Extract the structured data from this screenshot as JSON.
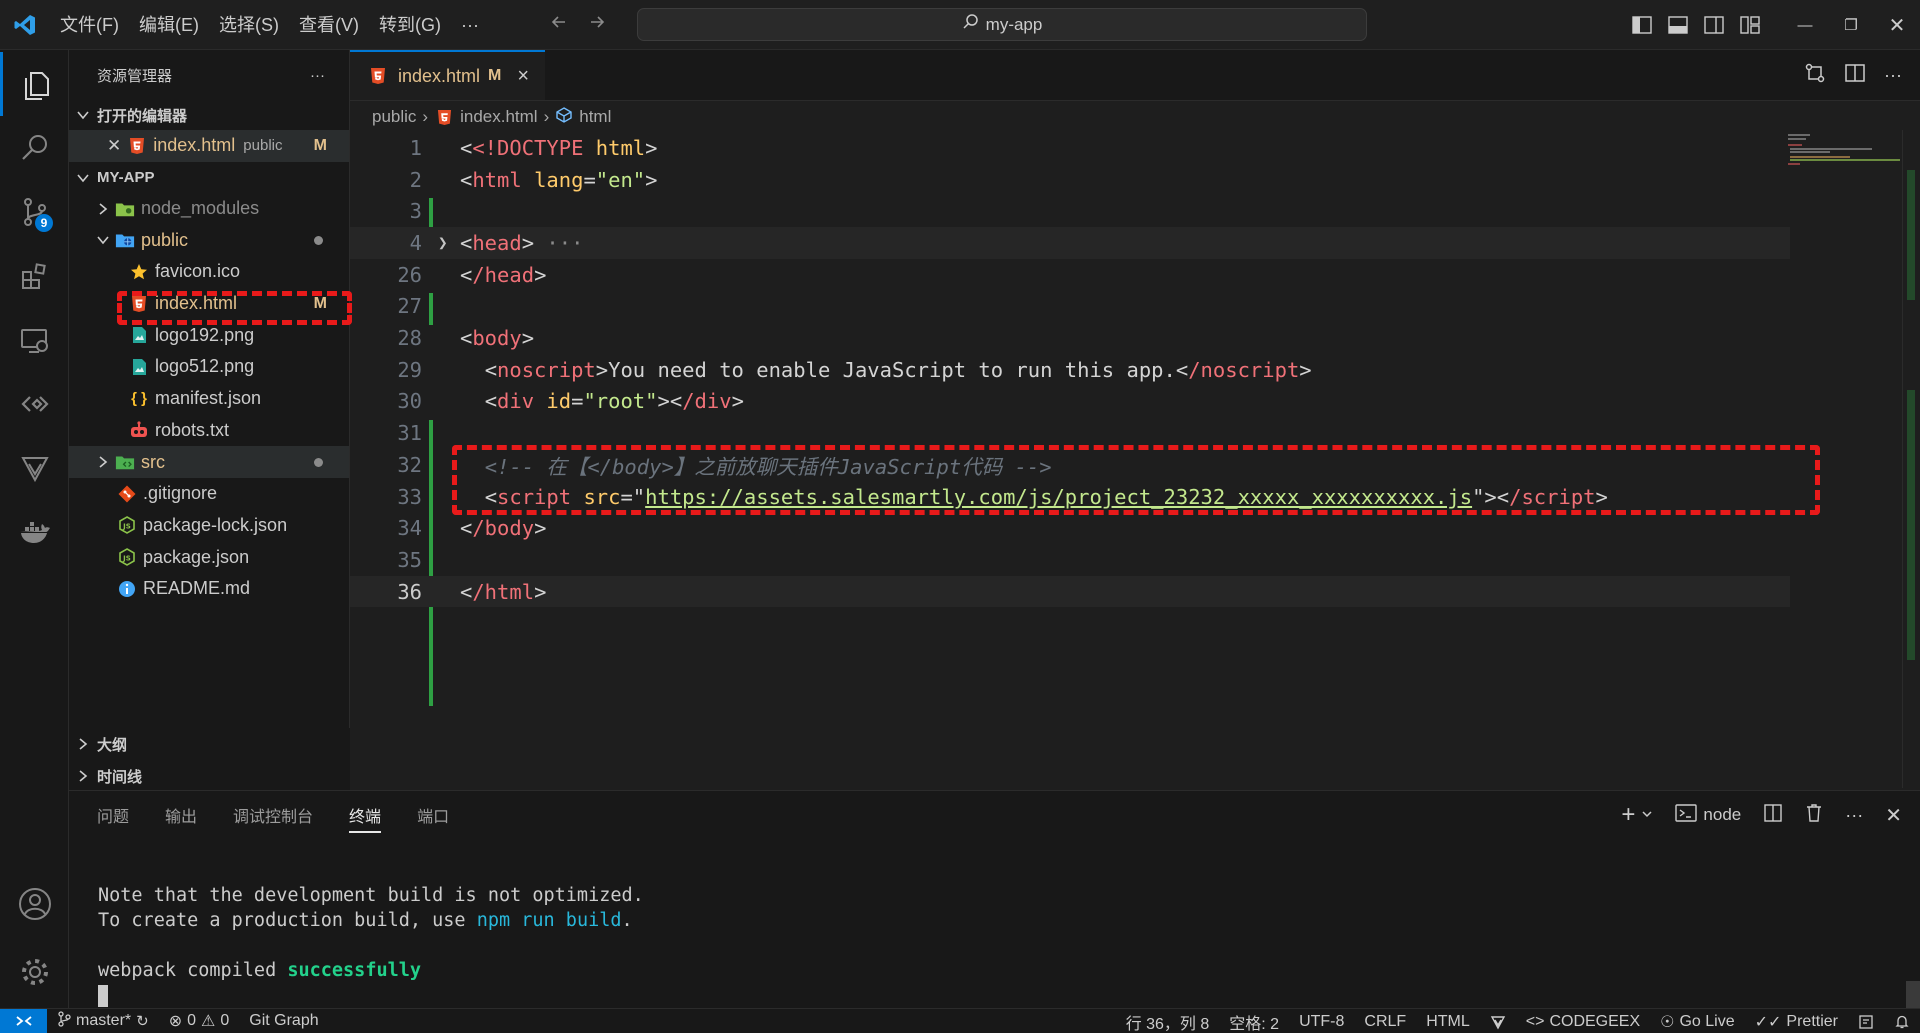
{
  "titlebar": {
    "menus": [
      "文件(F)",
      "编辑(E)",
      "选择(S)",
      "查看(V)",
      "转到(G)",
      "···"
    ],
    "search": "my-app"
  },
  "activity": {
    "scm_badge": "9"
  },
  "sidebar": {
    "header": "资源管理器",
    "more": "···",
    "open_editors": "打开的编辑器",
    "open_file": "index.html",
    "open_file_dir": "public",
    "open_file_mod": "M",
    "project": "MY-APP",
    "tree": [
      {
        "label": "node_modules"
      },
      {
        "label": "public"
      },
      {
        "label": "favicon.ico"
      },
      {
        "label": "index.html",
        "mod": "M"
      },
      {
        "label": "logo192.png"
      },
      {
        "label": "logo512.png"
      },
      {
        "label": "manifest.json"
      },
      {
        "label": "robots.txt"
      },
      {
        "label": "src"
      },
      {
        "label": ".gitignore"
      },
      {
        "label": "package-lock.json"
      },
      {
        "label": "package.json"
      },
      {
        "label": "README.md"
      }
    ],
    "outline": "大纲",
    "timeline": "时间线"
  },
  "tab": {
    "label": "index.html",
    "mod": "M",
    "close": "×"
  },
  "breadcrumb": {
    "folder": "public",
    "file": "index.html",
    "symbol": "html"
  },
  "editor": {
    "line_numbers": [
      "1",
      "2",
      "3",
      "4",
      "26",
      "27",
      "28",
      "29",
      "30",
      "31",
      "32",
      "33",
      "34",
      "35",
      "36"
    ],
    "l1": {
      "doctype": "<!DOCTYPE",
      "html": "html"
    },
    "l2": {
      "tag": "html",
      "attr": "lang",
      "value": "\"en\""
    },
    "l4": {
      "tag": "head",
      "ellipsis": "···"
    },
    "l26": {
      "tag": "/head"
    },
    "l28": {
      "tag": "body"
    },
    "l29": {
      "tag": "noscript",
      "text": "You need to enable JavaScript to run this app.",
      "endtag": "/noscript"
    },
    "l30": {
      "tag": "div",
      "attr": "id",
      "value": "\"root\"",
      "endtag": "/div"
    },
    "l32": {
      "comment": "<!-- 在【</body>】之前放聊天插件JavaScript代码 -->"
    },
    "l33": {
      "tag": "script",
      "attr": "src",
      "url": "https://assets.salesmartly.com/js/project_23232_xxxxx_xxxxxxxxxx.js",
      "endtag": "/script"
    },
    "l34": {
      "tag": "/body"
    },
    "l36": {
      "tag": "/html"
    }
  },
  "panel": {
    "tabs": [
      "问题",
      "输出",
      "调试控制台",
      "终端",
      "端口"
    ],
    "active_tab": "终端",
    "shell": "node",
    "terminal": {
      "line1": "Note that the development build is not optimized.",
      "line2_pre": "To create a production build, use ",
      "line2_cmd": "npm run build",
      "line2_post": ".",
      "line3_pre": "webpack compiled ",
      "line3_ok": "successfully"
    }
  },
  "status": {
    "branch": "master*",
    "errors": "0",
    "warnings": "0",
    "git_graph": "Git Graph",
    "position": "行 36，列 8",
    "spaces": "空格: 2",
    "encoding": "UTF-8",
    "eol": "CRLF",
    "language": "HTML",
    "codegeex": "CODEGEEX",
    "golive": "Go Live",
    "prettier": "Prettier"
  },
  "colors": {
    "accent": "#0078d4",
    "annotation": "#e81a1a",
    "modified": "#e2c08d"
  }
}
